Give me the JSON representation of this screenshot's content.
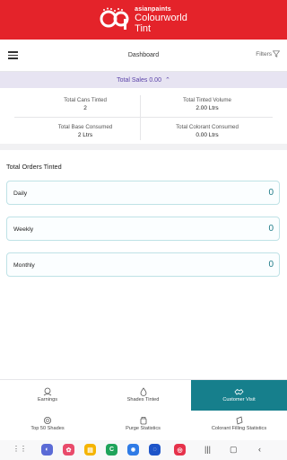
{
  "brand": {
    "line1": "asianpaints",
    "line2": "Colourworld",
    "line3": "Tint",
    "color": "#e4232a"
  },
  "header": {
    "title": "Dashboard",
    "filters_label": "Filters"
  },
  "sales": {
    "label": "Total Sales",
    "value": "0.00",
    "accent": "#5b43a8"
  },
  "stats": [
    {
      "label": "Total Cans Tinted",
      "value": "2"
    },
    {
      "label": "Total Tinted Volume",
      "value": "2.00 Ltrs"
    },
    {
      "label": "Total Base Consumed",
      "value": "2 Ltrs"
    },
    {
      "label": "Total Colorant Consumed",
      "value": "0.00 Ltrs"
    }
  ],
  "orders": {
    "title": "Total Orders Tinted",
    "rows": [
      {
        "label": "Daily",
        "value": "0"
      },
      {
        "label": "Weekly",
        "value": "0"
      },
      {
        "label": "Monthly",
        "value": "0"
      }
    ]
  },
  "tabs": [
    {
      "label": "Earnings",
      "icon": "earnings-icon"
    },
    {
      "label": "Shades Tinted",
      "icon": "drop-icon"
    },
    {
      "label": "Customer Visit",
      "icon": "handshake-icon",
      "active": true
    },
    {
      "label": "Top 50 Shades",
      "icon": "badge-icon"
    },
    {
      "label": "Purge Statistics",
      "icon": "purge-icon"
    },
    {
      "label": "Colorant Filling Statistics",
      "icon": "can-icon"
    }
  ],
  "accent": "#167f8c"
}
